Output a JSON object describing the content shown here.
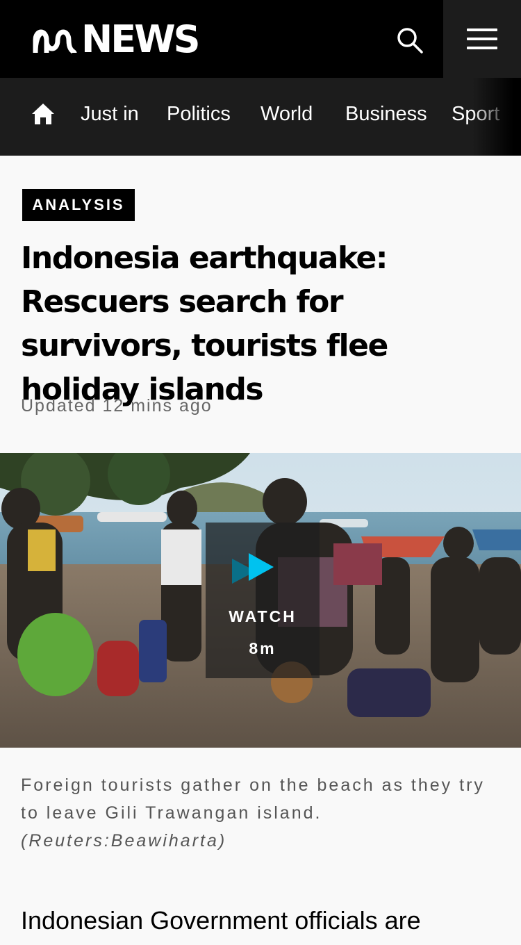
{
  "header": {
    "brand": "NEWS",
    "icons": {
      "search": "search-icon",
      "menu": "hamburger-menu-icon",
      "logo": "abc-logo-icon",
      "home": "home-icon"
    },
    "colors": {
      "topbar": "#000000",
      "nav": "#1c1c1c",
      "play_accent": "#00c2ef"
    }
  },
  "nav": {
    "items": [
      {
        "label": "Just in"
      },
      {
        "label": "Politics"
      },
      {
        "label": "World"
      },
      {
        "label": "Business"
      },
      {
        "label": "Sport"
      }
    ]
  },
  "article": {
    "badge": "ANALYSIS",
    "headline": "Indonesia earthquake: Rescuers search for survivors, tourists flee holiday islands",
    "updated": "Updated 12 mins ago",
    "video": {
      "label": "WATCH",
      "duration": "8m"
    },
    "caption": {
      "text": "Foreign tourists gather on the beach as they try to leave Gili Trawangan island.",
      "credit": "(Reuters:Beawiharta)"
    },
    "body_first_line": "Indonesian Government officials are"
  }
}
